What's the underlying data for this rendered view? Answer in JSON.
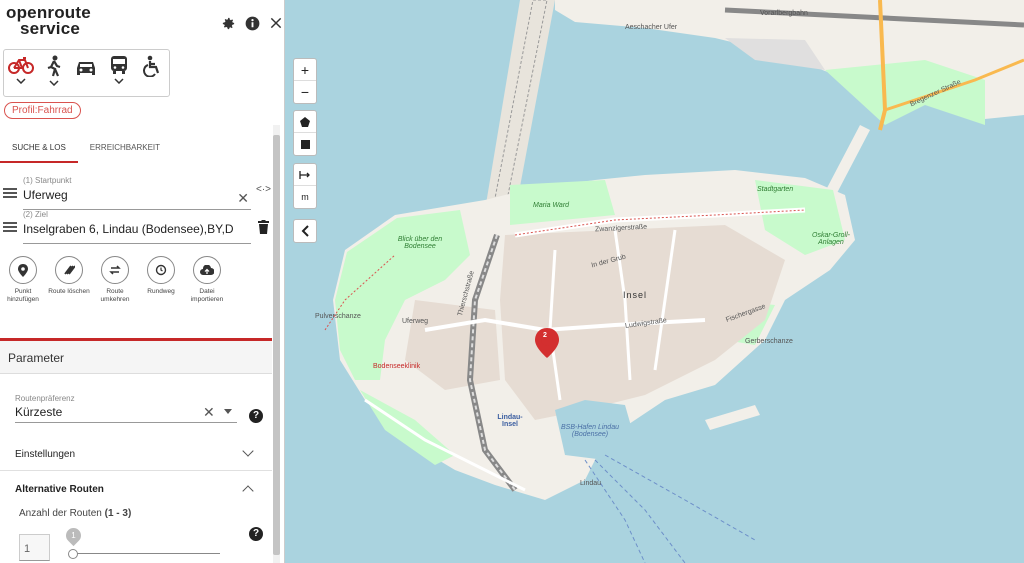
{
  "app": {
    "logo_line1": "openroute",
    "logo_line2": "service"
  },
  "profile_badge": "Profil:Fahrrad",
  "tabs": [
    {
      "label": "SUCHE & LOS"
    },
    {
      "label": "ERREICHBARKEIT"
    }
  ],
  "waypoints": [
    {
      "label": "(1) Startpunkt",
      "value": "Uferweg"
    },
    {
      "label": "(2) Ziel",
      "value": "Inselgraben 6, Lindau (Bodensee),BY,De"
    }
  ],
  "swap_label": "<·>",
  "actions": [
    {
      "label": "Punkt hinzufügen"
    },
    {
      "label": "Route löschen"
    },
    {
      "label": "Route umkehren"
    },
    {
      "label": "Rundweg"
    },
    {
      "label": "Datei importieren"
    }
  ],
  "params": {
    "title": "Parameter",
    "pref_label": "Routenpräferenz",
    "pref_value": "Kürzeste",
    "settings": "Einstellungen",
    "alt_routes": "Alternative Routen",
    "count_label": "Anzahl der Routen",
    "count_range": "(1 - 3)",
    "count_value": "1",
    "slider_value": "1",
    "slider_fraction": 0
  },
  "map_controls": {
    "zoom_in": "+",
    "zoom_out": "−",
    "unit": "m"
  },
  "map_labels": {
    "aeschacher": "Aeschacher Ufer",
    "vorarlberg": "Vorarlbergbahn",
    "bregenzer": "Bregenzer Straße",
    "maria_ward": "Maria Ward",
    "zwanzig": "Zwanzigerstraße",
    "stadtgarten": "Stadtgarten",
    "oskar": "Oskar-Groll-Anlagen",
    "blick": "Blick über den Bodensee",
    "insel": "Insel",
    "uferweg": "Uferweg",
    "pulver": "Pulverschanze",
    "gerber": "Gerberschanze",
    "klinik": "Bodenseeklinik",
    "lindau_insel": "Lindau-Insel",
    "hafen": "BSB-Hafen Lindau (Bodensee)",
    "lindau": "Lindau",
    "fischer": "Fischergasse",
    "ludwig": "Ludwigstraße",
    "thier": "Thierschstraße",
    "grub": "In der Grub"
  },
  "marker_label": "2",
  "colors": {
    "accent": "#c62828",
    "water": "#aad3df",
    "land": "#f2efe9",
    "park": "#c8facc"
  }
}
